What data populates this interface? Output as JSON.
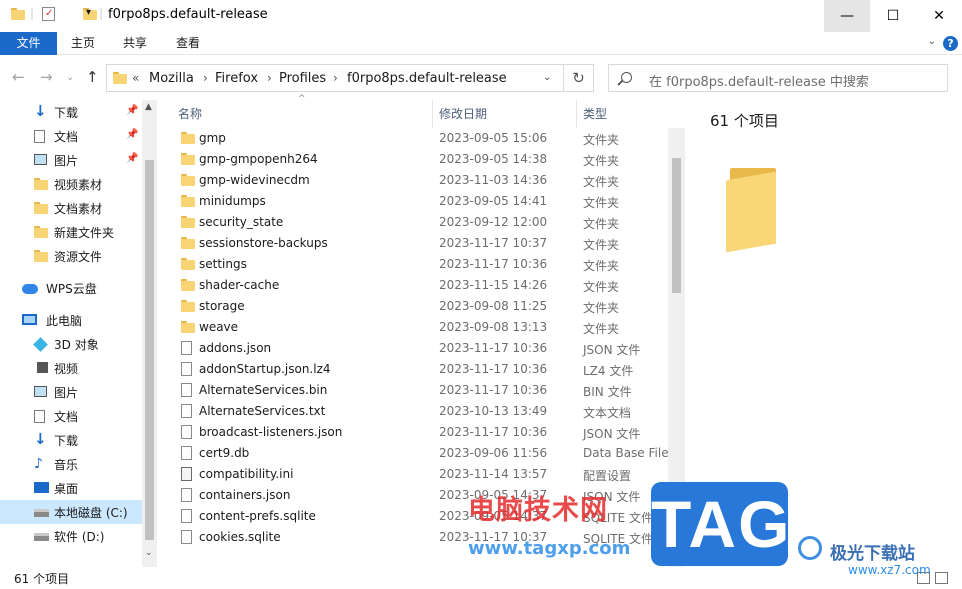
{
  "window": {
    "title": "f0rpo8ps.default-release",
    "minimize_icon": "—",
    "maximize_icon": "☐",
    "close_icon": "✕"
  },
  "ribbon": {
    "tabs": [
      "文件",
      "主页",
      "共享",
      "查看"
    ],
    "help": "?",
    "collapse": "⌄"
  },
  "address": {
    "back": "←",
    "forward": "→",
    "recent": "⌄",
    "up": "↑",
    "overflow": "«",
    "crumbs": [
      "Mozilla",
      "Firefox",
      "Profiles",
      "f0rpo8ps.default-release"
    ],
    "sep": "›",
    "dropdown": "⌄",
    "refresh": "↻",
    "search_placeholder": "在 f0rpo8ps.default-release 中搜索"
  },
  "nav": {
    "quick": [
      {
        "label": "下载",
        "icon": "download-icon",
        "pinned": true
      },
      {
        "label": "文档",
        "icon": "document-icon",
        "pinned": true
      },
      {
        "label": "图片",
        "icon": "pictures-icon",
        "pinned": true
      },
      {
        "label": "视频素材",
        "icon": "folder-icon",
        "pinned": false
      },
      {
        "label": "文档素材",
        "icon": "folder-icon",
        "pinned": false
      },
      {
        "label": "新建文件夹",
        "icon": "folder-icon",
        "pinned": false
      },
      {
        "label": "资源文件",
        "icon": "folder-icon",
        "pinned": false
      }
    ],
    "cloud": "WPS云盘",
    "pc": "此电脑",
    "pc_items": [
      {
        "label": "3D 对象",
        "icon": "3d-objects-icon"
      },
      {
        "label": "视频",
        "icon": "video-icon"
      },
      {
        "label": "图片",
        "icon": "pictures-icon"
      },
      {
        "label": "文档",
        "icon": "document-icon"
      },
      {
        "label": "下载",
        "icon": "download-icon"
      },
      {
        "label": "音乐",
        "icon": "music-icon"
      },
      {
        "label": "桌面",
        "icon": "desktop-icon"
      },
      {
        "label": "本地磁盘 (C:)",
        "icon": "drive-icon"
      },
      {
        "label": "软件 (D:)",
        "icon": "drive-icon"
      }
    ],
    "pin_glyph": "📌",
    "scroll_up": "▲",
    "scroll_down": "⌄"
  },
  "columns": {
    "name": "名称",
    "date": "修改日期",
    "type": "类型"
  },
  "files": [
    {
      "name": "gmp",
      "date": "2023-09-05 15:06",
      "type": "文件夹",
      "kind": "folder"
    },
    {
      "name": "gmp-gmpopenh264",
      "date": "2023-09-05 14:38",
      "type": "文件夹",
      "kind": "folder"
    },
    {
      "name": "gmp-widevinecdm",
      "date": "2023-11-03 14:36",
      "type": "文件夹",
      "kind": "folder"
    },
    {
      "name": "minidumps",
      "date": "2023-09-05 14:41",
      "type": "文件夹",
      "kind": "folder"
    },
    {
      "name": "security_state",
      "date": "2023-09-12 12:00",
      "type": "文件夹",
      "kind": "folder"
    },
    {
      "name": "sessionstore-backups",
      "date": "2023-11-17 10:37",
      "type": "文件夹",
      "kind": "folder"
    },
    {
      "name": "settings",
      "date": "2023-11-17 10:36",
      "type": "文件夹",
      "kind": "folder"
    },
    {
      "name": "shader-cache",
      "date": "2023-11-15 14:26",
      "type": "文件夹",
      "kind": "folder"
    },
    {
      "name": "storage",
      "date": "2023-09-08 11:25",
      "type": "文件夹",
      "kind": "folder"
    },
    {
      "name": "weave",
      "date": "2023-09-08 13:13",
      "type": "文件夹",
      "kind": "folder"
    },
    {
      "name": "addons.json",
      "date": "2023-11-17 10:36",
      "type": "JSON 文件",
      "kind": "file"
    },
    {
      "name": "addonStartup.json.lz4",
      "date": "2023-11-17 10:36",
      "type": "LZ4 文件",
      "kind": "file"
    },
    {
      "name": "AlternateServices.bin",
      "date": "2023-11-17 10:36",
      "type": "BIN 文件",
      "kind": "file"
    },
    {
      "name": "AlternateServices.txt",
      "date": "2023-10-13 13:49",
      "type": "文本文档",
      "kind": "file"
    },
    {
      "name": "broadcast-listeners.json",
      "date": "2023-11-17 10:36",
      "type": "JSON 文件",
      "kind": "file"
    },
    {
      "name": "cert9.db",
      "date": "2023-09-06 11:56",
      "type": "Data Base File",
      "kind": "file"
    },
    {
      "name": "compatibility.ini",
      "date": "2023-11-14 13:57",
      "type": "配置设置",
      "kind": "settings"
    },
    {
      "name": "containers.json",
      "date": "2023-09-05 14:37",
      "type": "JSON 文件",
      "kind": "file"
    },
    {
      "name": "content-prefs.sqlite",
      "date": "2023-09-05 14:37",
      "type": "SQLITE 文件",
      "kind": "file"
    },
    {
      "name": "cookies.sqlite",
      "date": "2023-11-17 10:37",
      "type": "SQLITE 文件",
      "kind": "file"
    }
  ],
  "preview": {
    "count": "61 个项目"
  },
  "status": {
    "text": "61 个项目"
  },
  "watermark": {
    "site_cn": "电脑技术网",
    "site_url": "www.tagxp.com",
    "tag": "TAG",
    "logo_text": "极光下载站",
    "logo_url": "www.xz7.com"
  }
}
